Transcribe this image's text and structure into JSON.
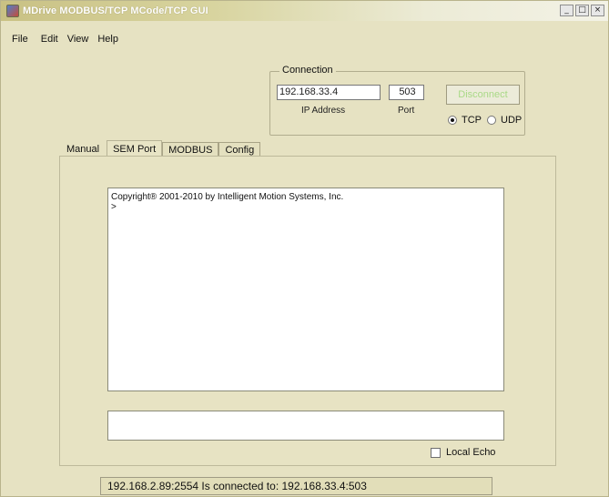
{
  "window": {
    "title": "MDrive MODBUS/TCP MCode/TCP GUI",
    "controls": {
      "minimize": "_",
      "maximize": "□",
      "close": "×"
    }
  },
  "menu": {
    "items": [
      "File",
      "Edit",
      "View",
      "Help"
    ]
  },
  "connection": {
    "group_title": "Connection",
    "ip_value": "192.168.33.4",
    "ip_label": "IP Address",
    "port_value": "503",
    "port_label": "Port",
    "disconnect_label": "Disconnect",
    "tcp_label": "TCP",
    "udp_label": "UDP",
    "protocol_selected": "TCP"
  },
  "tabs": {
    "items": [
      "Manual",
      "SEM Port",
      "MODBUS",
      "Config"
    ],
    "active": "SEM Port"
  },
  "console": {
    "lines": [
      "Copyright® 2001-2010 by Intelligent Motion Systems, Inc.",
      ">"
    ]
  },
  "input": {
    "value": ""
  },
  "local_echo": {
    "label": "Local Echo",
    "checked": false
  },
  "status": {
    "text": "192.168.2.89:2554 Is connected to: 192.168.33.4:503"
  },
  "colors": {
    "background": "#e6e2c2",
    "titlebar": "#c9c184",
    "disconnect_text": "#a9d986"
  }
}
